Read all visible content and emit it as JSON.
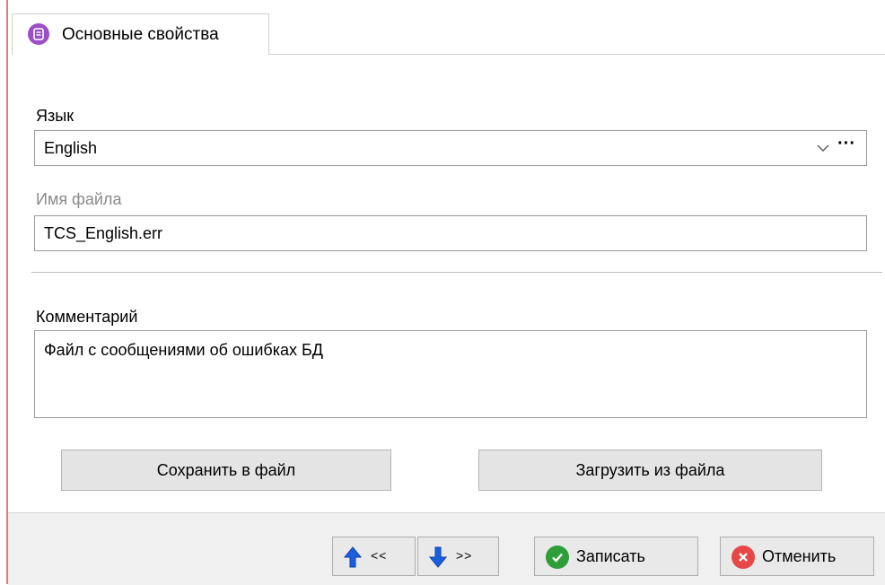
{
  "tab": {
    "label": "Основные свойства",
    "icon": "form-icon",
    "icon_color": "#9b4fc7"
  },
  "language": {
    "label": "Язык",
    "value": "English",
    "ellipsis": "···"
  },
  "filename": {
    "label": "Имя файла",
    "value": "TCS_English.err"
  },
  "comment": {
    "label": "Комментарий",
    "value": "Файл с сообщениями об ошибках БД"
  },
  "actions": {
    "save_to_file": "Сохранить в файл",
    "load_from_file": "Загрузить из файла"
  },
  "footer": {
    "prev_label": "<<",
    "next_label": ">>",
    "save_label": "Записать",
    "cancel_label": "Отменить",
    "colors": {
      "arrow": "#1a5fe0",
      "save": "#2e9e3a",
      "cancel": "#e84747"
    }
  }
}
